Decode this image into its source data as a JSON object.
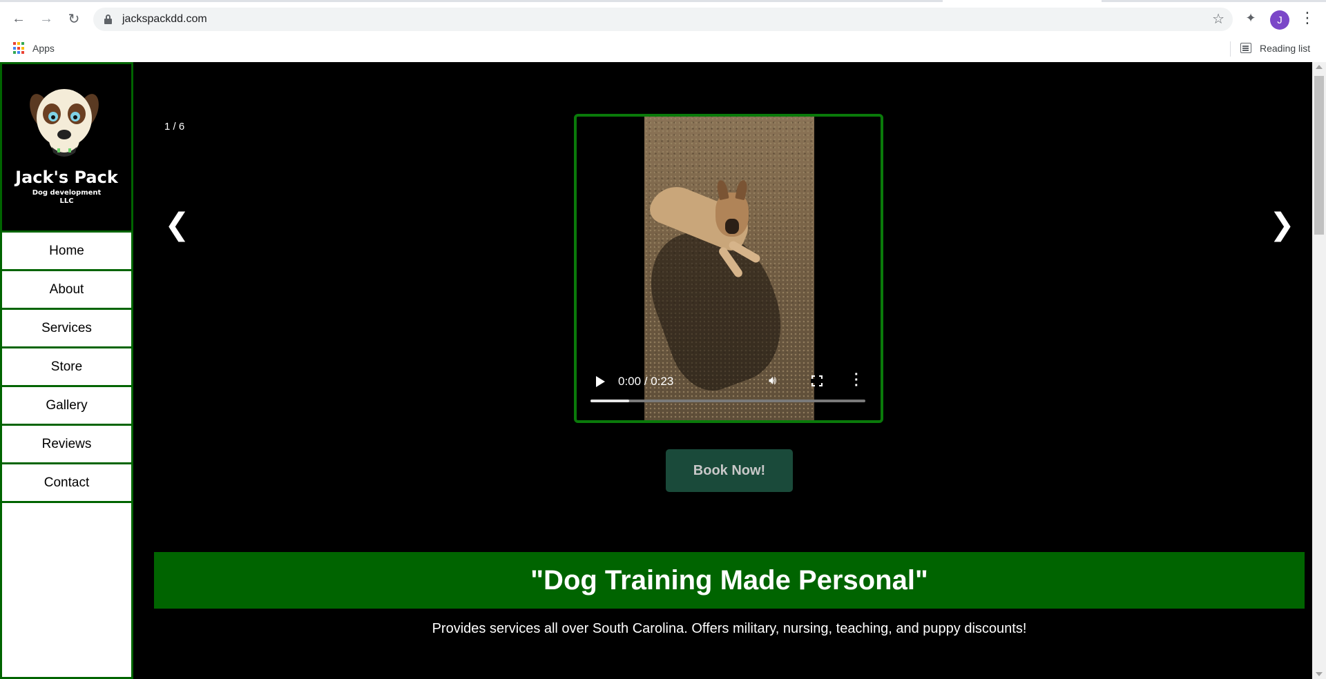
{
  "browser": {
    "url": "jackspackdd.com",
    "bookmarks": {
      "apps_label": "Apps",
      "reading_list_label": "Reading list"
    },
    "avatar_initial": "J",
    "icons": [
      "back-icon",
      "forward-icon",
      "reload-icon",
      "lock-icon",
      "star-icon",
      "extensions-icon",
      "menu-icon"
    ]
  },
  "sidebar": {
    "logo": {
      "name": "Jack's Pack",
      "subtitle": "Dog development",
      "suffix": "LLC"
    },
    "items": [
      {
        "label": "Home"
      },
      {
        "label": "About"
      },
      {
        "label": "Services"
      },
      {
        "label": "Store"
      },
      {
        "label": "Gallery"
      },
      {
        "label": "Reviews"
      },
      {
        "label": "Contact"
      }
    ]
  },
  "slideshow": {
    "counter": "1 / 6",
    "prev": "❮",
    "next": "❯",
    "video": {
      "time": "0:00 / 0:23",
      "progress": 0.14
    }
  },
  "cta": {
    "book_label": "Book Now!"
  },
  "tagline": "\"Dog Training Made Personal\"",
  "description": "Provides services all over South Carolina. Offers military, nursing, teaching, and puppy discounts!",
  "colors": {
    "accent": "#006400",
    "button_bg": "#1a4a3a",
    "page_bg": "#000000"
  }
}
